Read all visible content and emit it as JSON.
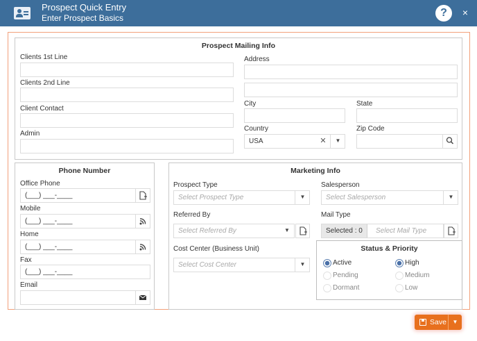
{
  "window": {
    "title": "Prospect Quick Entry",
    "subtitle": "Enter Prospect Basics",
    "help_label": "?",
    "close_label": "×",
    "accent_color": "#3d6e9b"
  },
  "mailing": {
    "title": "Prospect Mailing Info",
    "clients_1st_line": {
      "label": "Clients 1st Line",
      "value": ""
    },
    "clients_2nd_line": {
      "label": "Clients 2nd Line",
      "value": ""
    },
    "client_contact": {
      "label": "Client Contact",
      "value": ""
    },
    "admin": {
      "label": "Admin",
      "value": ""
    },
    "address": {
      "label": "Address",
      "value": "",
      "value2": ""
    },
    "city": {
      "label": "City",
      "value": ""
    },
    "state": {
      "label": "State",
      "value": ""
    },
    "country": {
      "label": "Country",
      "value": "USA"
    },
    "zip": {
      "label": "Zip Code",
      "value": ""
    }
  },
  "phone": {
    "title": "Phone Number",
    "office": {
      "label": "Office Phone",
      "value": "(___) ___-____"
    },
    "mobile": {
      "label": "Mobile",
      "value": "(___) ___-____"
    },
    "home": {
      "label": "Home",
      "value": "(___) ___-____"
    },
    "fax": {
      "label": "Fax",
      "value": "(___) ___-____"
    },
    "email": {
      "label": "Email",
      "value": ""
    }
  },
  "marketing": {
    "title": "Marketing Info",
    "prospect_type": {
      "label": "Prospect Type",
      "placeholder": "Select Prospect Type"
    },
    "salesperson": {
      "label": "Salesperson",
      "placeholder": "Select Salesperson"
    },
    "referred_by": {
      "label": "Referred By",
      "placeholder": "Select Referred By"
    },
    "mail_type": {
      "label": "Mail Type",
      "chip": "Selected : 0",
      "placeholder": "Select Mail Type"
    },
    "cost_center": {
      "label": "Cost Center (Business Unit)",
      "placeholder": "Select Cost Center"
    }
  },
  "status": {
    "title": "Status & Priority",
    "options": [
      "Active",
      "Pending",
      "Dormant"
    ],
    "selected": "Active",
    "priority_options": [
      "High",
      "Medium",
      "Low"
    ],
    "priority_selected": "High"
  },
  "footer": {
    "save_label": "Save",
    "save_color": "#e8701e"
  },
  "icons": {
    "contact_card": "contact-card-icon",
    "help": "help-icon",
    "close": "close-icon",
    "add_note": "add-note-icon",
    "rss": "rss-icon",
    "mail": "mail-icon",
    "search": "search-icon",
    "dropdown": "chevron-down-icon",
    "save": "save-icon"
  }
}
